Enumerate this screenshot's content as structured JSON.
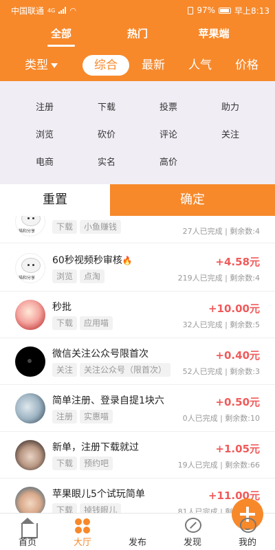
{
  "status_bar": {
    "carrier": "中国联通",
    "network": "4G",
    "battery": "97%",
    "time": "早上8:13"
  },
  "top_tabs": [
    {
      "label": "全部",
      "active": true
    },
    {
      "label": "热门",
      "active": false
    },
    {
      "label": "苹果端",
      "active": false
    }
  ],
  "sort_bar": {
    "type_label": "类型",
    "items": [
      {
        "label": "综合",
        "active": true
      },
      {
        "label": "最新",
        "active": false
      },
      {
        "label": "人气",
        "active": false
      },
      {
        "label": "价格",
        "active": false
      }
    ]
  },
  "filter": {
    "rows": [
      [
        "注册",
        "下载",
        "投票",
        "助力"
      ],
      [
        "浏览",
        "砍价",
        "评论",
        "关注"
      ],
      [
        "电商",
        "实名",
        "高价"
      ]
    ],
    "reset_label": "重置",
    "confirm_label": "确定"
  },
  "tasks": [
    {
      "title": "",
      "tags": [
        "下载",
        "小鱼赚钱"
      ],
      "price": "",
      "completed": "27人已完成",
      "remaining": "剩余数:4",
      "avatar": "cat-logo-icon"
    },
    {
      "title": "60秒视频秒审核",
      "fire": true,
      "tags": [
        "浏览",
        "点淘"
      ],
      "price": "+4.58元",
      "completed": "219人已完成",
      "remaining": "剩余数:4",
      "avatar": "cat-logo-icon"
    },
    {
      "title": "秒批",
      "tags": [
        "下载",
        "应用喵"
      ],
      "price": "+10.00元",
      "completed": "32人已完成",
      "remaining": "剩余数:5",
      "avatar": "pink-avatar"
    },
    {
      "title": "微信关注公众号限首次",
      "tags": [
        "关注",
        "关注公众号（限首次）"
      ],
      "price": "+0.40元",
      "completed": "52人已完成",
      "remaining": "剩余数:3",
      "avatar": "black-avatar"
    },
    {
      "title": "简单注册、登录自提1块六",
      "tags": [
        "注册",
        "实惠喵"
      ],
      "price": "+0.50元",
      "completed": "0人已完成",
      "remaining": "剩余数:10",
      "avatar": "blue-avatar"
    },
    {
      "title": "新单，注册下载就过",
      "tags": [
        "下载",
        "预约吧"
      ],
      "price": "+1.05元",
      "completed": "19人已完成",
      "remaining": "剩余数:66",
      "avatar": "face-avatar"
    },
    {
      "title": "苹果眼儿5个试玩简单",
      "tags": [
        "下载",
        "掉钱眼儿"
      ],
      "price": "+11.00元",
      "completed": "81人已完成",
      "remaining": "剩余数:23",
      "avatar": "boy-avatar"
    }
  ],
  "bottom_nav": [
    {
      "label": "首页",
      "icon": "home-icon",
      "active": false
    },
    {
      "label": "大厅",
      "icon": "hall-icon",
      "active": true
    },
    {
      "label": "发布",
      "icon": "publish-plus-icon",
      "active": false
    },
    {
      "label": "发现",
      "icon": "discover-icon",
      "active": false
    },
    {
      "label": "我的",
      "icon": "profile-icon",
      "active": false
    }
  ],
  "colors": {
    "accent": "#f7892b",
    "price": "#f05a5a",
    "panel": "#f1edf5"
  }
}
